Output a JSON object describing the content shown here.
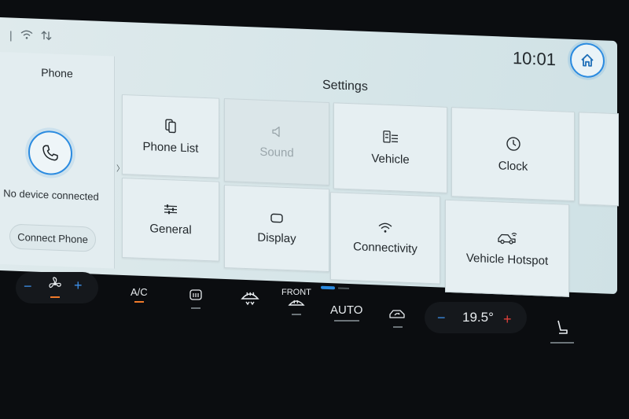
{
  "status": {
    "time": "10:01"
  },
  "phone": {
    "title": "Phone",
    "status_text": "No device connected",
    "connect_label": "Connect Phone"
  },
  "settings": {
    "title": "Settings",
    "tiles": [
      {
        "label": "Phone List",
        "icon": "phone-list-icon",
        "enabled": true
      },
      {
        "label": "Sound",
        "icon": "speaker-icon",
        "enabled": false
      },
      {
        "label": "Vehicle",
        "icon": "vehicle-settings-icon",
        "enabled": true
      },
      {
        "label": "Clock",
        "icon": "clock-icon",
        "enabled": true
      },
      {
        "label": "General",
        "icon": "sliders-icon",
        "enabled": true
      },
      {
        "label": "Display",
        "icon": "display-icon",
        "enabled": true
      },
      {
        "label": "Connectivity",
        "icon": "wifi-icon",
        "enabled": true
      },
      {
        "label": "Vehicle Hotspot",
        "icon": "car-wifi-icon",
        "enabled": true
      }
    ]
  },
  "climate": {
    "ac_label": "A/C",
    "front_label": "FRONT",
    "auto_label": "AUTO",
    "temperature": "19.5°",
    "minus": "−",
    "plus": "+"
  },
  "colors": {
    "accent": "#2b8be0",
    "climate_on": "#f07a2a",
    "plus_red": "#e0413a"
  }
}
